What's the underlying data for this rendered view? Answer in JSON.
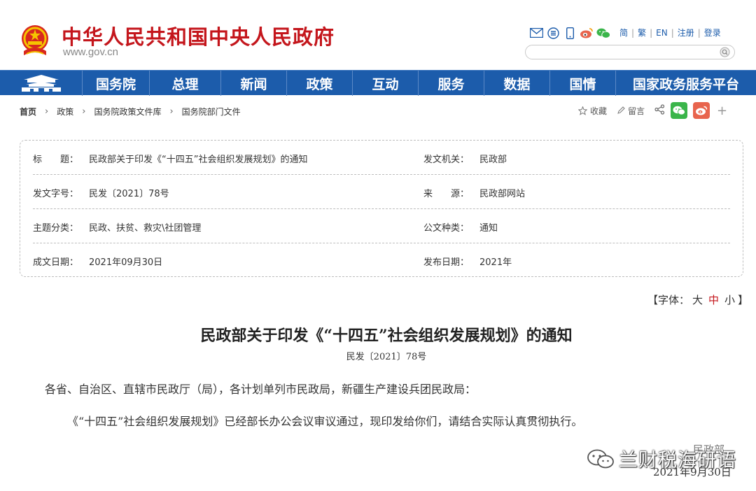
{
  "header": {
    "site_name": "中华人民共和国中央人民政府",
    "site_url": "www.gov.cn",
    "top_links": [
      "简",
      "繁",
      "EN",
      "注册",
      "登录"
    ],
    "icons": [
      "mail-icon",
      "rss-icon",
      "mobile-icon",
      "weibo-icon",
      "wechat-icon"
    ],
    "search": {
      "placeholder": ""
    }
  },
  "nav": {
    "items": [
      "国务院",
      "总理",
      "新闻",
      "政策",
      "互动",
      "服务",
      "数据",
      "国情",
      "国家政务服务平台"
    ]
  },
  "breadcrumb": [
    "首页",
    "政策",
    "国务院政策文件库",
    "国务院部门文件"
  ],
  "tools": {
    "favorite": "收藏",
    "comment": "留言"
  },
  "info": {
    "rows": [
      {
        "label_left": "标　　题：",
        "value_left": "民政部关于印发《“十四五”社会组织发展规划》的通知",
        "label_right": "发文机关：",
        "value_right": "民政部"
      },
      {
        "label_left": "发文字号：",
        "value_left": "民发〔2021〕78号",
        "label_right": "来　　源：",
        "value_right": "民政部网站"
      },
      {
        "label_left": "主题分类：",
        "value_left": "民政、扶贫、救灾\\社团管理",
        "label_right": "公文种类：",
        "value_right": "通知"
      },
      {
        "label_left": "成文日期：",
        "value_left": "2021年09月30日",
        "label_right": "发布日期：",
        "value_right": "2021年"
      }
    ]
  },
  "font_control": {
    "open": "【字体：",
    "large": "大",
    "medium": "中",
    "small": "小",
    "close": "】"
  },
  "article": {
    "title": "民政部关于印发《“十四五”社会组织发展规划》的通知",
    "doc_no": "民发〔2021〕78号",
    "p1": "各省、自治区、直辖市民政厅（局），各计划单列市民政局，新疆生产建设兵团民政局：",
    "p2": "《“十四五”社会组织发展规划》已经部长办公会议审议通过，现印发给你们，请结合实际认真贯彻执行。"
  },
  "signature": {
    "org": "民政部",
    "date": "2021年9月30日"
  },
  "watermark": {
    "text": "兰财税海研语"
  },
  "colors": {
    "brand_red": "#c4161c",
    "nav_blue": "#1c5cab",
    "wechat_green": "#3ab54a",
    "weibo_orange": "#e8644d"
  }
}
